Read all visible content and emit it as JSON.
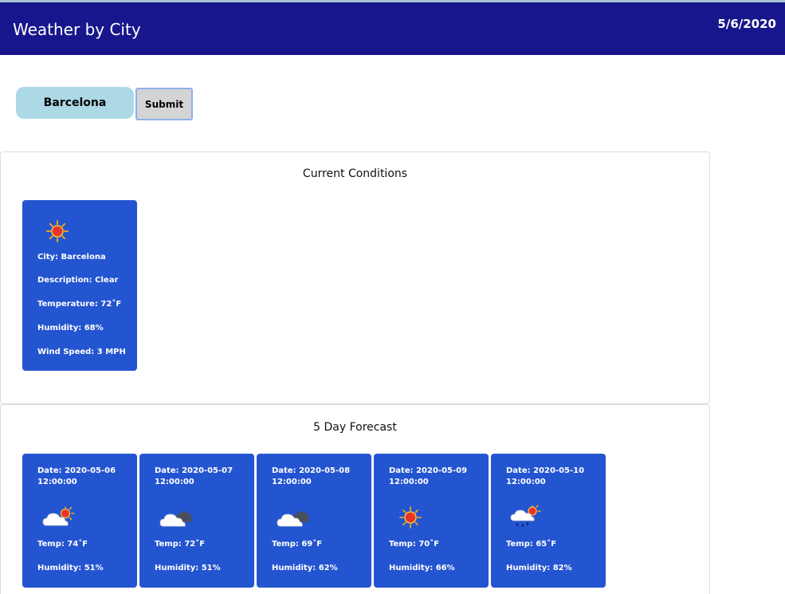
{
  "header": {
    "title": "Weather by City",
    "date": "5/6/2020"
  },
  "search": {
    "value": "Barcelona",
    "submit_label": "Submit"
  },
  "current": {
    "title": "Current Conditions",
    "icon": "sun-icon",
    "city": "City: Barcelona",
    "description": "Description: Clear",
    "temperature": "Temperature: 72˚F",
    "humidity": "Humidity: 68%",
    "wind": "Wind Speed: 3 MPH"
  },
  "forecast": {
    "title": "5 Day Forecast",
    "days": [
      {
        "date": "Date: 2020-05-06 12:00:00",
        "icon": "sun-behind-cloud-icon",
        "temp": "Temp: 74˚F",
        "humidity": "Humidity: 51%"
      },
      {
        "date": "Date: 2020-05-07 12:00:00",
        "icon": "cloudy-icon",
        "temp": "Temp: 72˚F",
        "humidity": "Humidity: 51%"
      },
      {
        "date": "Date: 2020-05-08 12:00:00",
        "icon": "cloudy-icon",
        "temp": "Temp: 69˚F",
        "humidity": "Humidity: 62%"
      },
      {
        "date": "Date: 2020-05-09 12:00:00",
        "icon": "sun-icon",
        "temp": "Temp: 70˚F",
        "humidity": "Humidity: 66%"
      },
      {
        "date": "Date: 2020-05-10 12:00:00",
        "icon": "sun-rain-cloud-icon",
        "temp": "Temp: 65˚F",
        "humidity": "Humidity: 82%"
      }
    ]
  },
  "colors": {
    "header_bg": "#18168c",
    "card_bg": "#2455d0",
    "input_bg": "#add8e6",
    "button_bg": "#d4d4d4"
  }
}
